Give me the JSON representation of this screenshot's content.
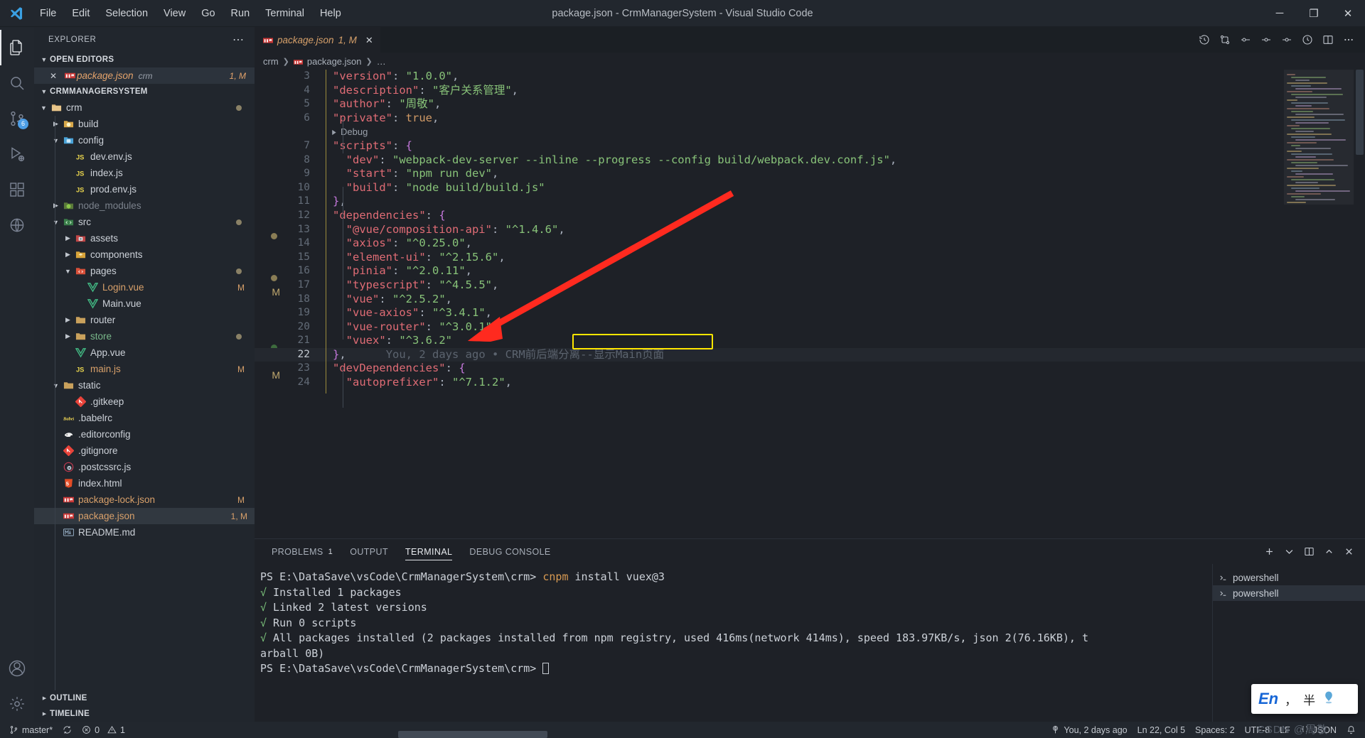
{
  "window": {
    "title": "package.json - CrmManagerSystem - Visual Studio Code",
    "minimize": "─",
    "maximize": "❐",
    "close": "✕"
  },
  "menu": [
    "File",
    "Edit",
    "Selection",
    "View",
    "Go",
    "Run",
    "Terminal",
    "Help"
  ],
  "activitybar": {
    "items": [
      {
        "name": "explorer-icon",
        "badge": ""
      },
      {
        "name": "search-icon",
        "badge": ""
      },
      {
        "name": "source-control-icon",
        "badge": "6"
      },
      {
        "name": "run-debug-icon",
        "badge": ""
      },
      {
        "name": "extensions-icon",
        "badge": ""
      },
      {
        "name": "remote-explorer-icon",
        "badge": ""
      }
    ],
    "bottom": [
      {
        "name": "accounts-icon"
      },
      {
        "name": "settings-gear-icon"
      }
    ]
  },
  "sidebar": {
    "title": "EXPLORER",
    "more_actions": "⋯",
    "open_editors": {
      "label": "OPEN EDITORS",
      "items": [
        {
          "name": "package.json",
          "sub": "crm",
          "badge": "1, M"
        }
      ]
    },
    "project": {
      "label": "CRMMANAGERSYSTEM",
      "tree": [
        {
          "label": "crm",
          "indent": 0,
          "kind": "folder-open",
          "icon": "folder-crm",
          "dot": true
        },
        {
          "label": "build",
          "indent": 1,
          "kind": "folder",
          "icon": "folder-build"
        },
        {
          "label": "config",
          "indent": 1,
          "kind": "folder-open",
          "icon": "folder-config"
        },
        {
          "label": "dev.env.js",
          "indent": 2,
          "kind": "file",
          "icon": "js"
        },
        {
          "label": "index.js",
          "indent": 2,
          "kind": "file",
          "icon": "js"
        },
        {
          "label": "prod.env.js",
          "indent": 2,
          "kind": "file",
          "icon": "js"
        },
        {
          "label": "node_modules",
          "indent": 1,
          "kind": "folder",
          "icon": "folder-node",
          "dim": true
        },
        {
          "label": "src",
          "indent": 1,
          "kind": "folder-open",
          "icon": "folder-src",
          "dot": true
        },
        {
          "label": "assets",
          "indent": 2,
          "kind": "folder",
          "icon": "folder-assets"
        },
        {
          "label": "components",
          "indent": 2,
          "kind": "folder",
          "icon": "folder-components"
        },
        {
          "label": "pages",
          "indent": 2,
          "kind": "folder-open",
          "icon": "folder-pages",
          "dot": true
        },
        {
          "label": "Login.vue",
          "indent": 3,
          "kind": "file",
          "icon": "vue",
          "badge": "M",
          "color": "orange"
        },
        {
          "label": "Main.vue",
          "indent": 3,
          "kind": "file",
          "icon": "vue"
        },
        {
          "label": "router",
          "indent": 2,
          "kind": "folder",
          "icon": "folder-plain"
        },
        {
          "label": "store",
          "indent": 2,
          "kind": "folder",
          "icon": "folder-plain",
          "color": "green",
          "dot": true
        },
        {
          "label": "App.vue",
          "indent": 2,
          "kind": "file",
          "icon": "vue"
        },
        {
          "label": "main.js",
          "indent": 2,
          "kind": "file",
          "icon": "js",
          "badge": "M",
          "color": "orange"
        },
        {
          "label": "static",
          "indent": 1,
          "kind": "folder-open",
          "icon": "folder-plain"
        },
        {
          "label": ".gitkeep",
          "indent": 2,
          "kind": "file",
          "icon": "git"
        },
        {
          "label": ".babelrc",
          "indent": 1,
          "kind": "file",
          "icon": "babel"
        },
        {
          "label": ".editorconfig",
          "indent": 1,
          "kind": "file",
          "icon": "editorconfig"
        },
        {
          "label": ".gitignore",
          "indent": 1,
          "kind": "file",
          "icon": "git"
        },
        {
          "label": ".postcssrc.js",
          "indent": 1,
          "kind": "file",
          "icon": "postcss"
        },
        {
          "label": "index.html",
          "indent": 1,
          "kind": "file",
          "icon": "html"
        },
        {
          "label": "package-lock.json",
          "indent": 1,
          "kind": "file",
          "icon": "npm",
          "badge": "M",
          "color": "orange"
        },
        {
          "label": "package.json",
          "indent": 1,
          "kind": "file",
          "icon": "npm",
          "badge": "1, M",
          "color": "orange",
          "selected": true
        },
        {
          "label": "README.md",
          "indent": 1,
          "kind": "file",
          "icon": "md"
        }
      ]
    },
    "outline": "OUTLINE",
    "timeline": "TIMELINE"
  },
  "editor": {
    "tab": {
      "label": "package.json",
      "badge": "1, M",
      "close": "✕"
    },
    "breadcrumb": [
      "crm",
      "package.json",
      "…"
    ],
    "codelens": "Debug",
    "blame": "You, 2 days ago • CRM前后端分离--显示Main页面",
    "lines": [
      {
        "n": "3",
        "html": "<span class=\"k\">\"version\"</span><span class=\"col\">: </span><span class=\"s\">\"1.0.0\"</span><span class=\"col\">,</span>",
        "indent": 1
      },
      {
        "n": "4",
        "html": "<span class=\"k\">\"description\"</span><span class=\"col\">: </span><span class=\"s\">\"客户关系管理\"</span><span class=\"col\">,</span>",
        "indent": 1
      },
      {
        "n": "5",
        "html": "<span class=\"k\">\"author\"</span><span class=\"col\">: </span><span class=\"s\">\"周敬\"</span><span class=\"col\">,</span>",
        "indent": 1
      },
      {
        "n": "6",
        "html": "<span class=\"k\">\"private\"</span><span class=\"col\">: </span><span class=\"num\">true</span><span class=\"col\">,</span>",
        "indent": 1
      },
      {
        "n": "7",
        "html": "<span class=\"k\">\"scripts\"</span><span class=\"col\">: </span><span class=\"p\">{</span>",
        "indent": 1
      },
      {
        "n": "8",
        "html": "  <span class=\"k\">\"dev\"</span><span class=\"col\">: </span><span class=\"s\">\"webpack-dev-server --inline --progress --config build/webpack.dev.conf.js\"</span><span class=\"col\">,</span>",
        "indent": 2
      },
      {
        "n": "9",
        "html": "  <span class=\"k\">\"start\"</span><span class=\"col\">: </span><span class=\"s\">\"npm run dev\"</span><span class=\"col\">,</span>",
        "indent": 2
      },
      {
        "n": "10",
        "html": "  <span class=\"k\">\"build\"</span><span class=\"col\">: </span><span class=\"s\">\"node build/build.js\"</span>",
        "indent": 2
      },
      {
        "n": "11",
        "html": "<span class=\"p\">}</span><span class=\"col\">,</span>",
        "indent": 1
      },
      {
        "n": "12",
        "html": "<span class=\"k\">\"dependencies\"</span><span class=\"col\">: </span><span class=\"p\">{</span>",
        "indent": 1
      },
      {
        "n": "13",
        "html": "  <span class=\"k\">\"@vue/composition-api\"</span><span class=\"col\">: </span><span class=\"s\">\"^1.4.6\"</span><span class=\"col\">,</span>",
        "indent": 2,
        "change": true,
        "glyphdot": true
      },
      {
        "n": "14",
        "html": "  <span class=\"k\">\"axios\"</span><span class=\"col\">: </span><span class=\"s\">\"^0.25.0\"</span><span class=\"col\">,</span>",
        "indent": 2
      },
      {
        "n": "15",
        "html": "  <span class=\"k\">\"element-ui\"</span><span class=\"col\">: </span><span class=\"s\">\"^2.15.6\"</span><span class=\"col\">,</span>",
        "indent": 2
      },
      {
        "n": "16",
        "html": "  <span class=\"k\">\"pinia\"</span><span class=\"col\">: </span><span class=\"s\">\"^2.0.11\"</span><span class=\"col\">,</span>",
        "indent": 2,
        "change": true,
        "glyphdot": true
      },
      {
        "n": "17",
        "html": "  <span class=\"k\">\"typescript\"</span><span class=\"col\">: </span><span class=\"s\">\"^4.5.5\"</span><span class=\"col\">,</span>",
        "indent": 2,
        "change": true,
        "glyphm": true
      },
      {
        "n": "18",
        "html": "  <span class=\"k\">\"vue\"</span><span class=\"col\">: </span><span class=\"s\">\"^2.5.2\"</span><span class=\"col\">,</span>",
        "indent": 2
      },
      {
        "n": "19",
        "html": "  <span class=\"k\">\"vue-axios\"</span><span class=\"col\">: </span><span class=\"s\">\"^3.4.1\"</span><span class=\"col\">,</span>",
        "indent": 2
      },
      {
        "n": "20",
        "html": "  <span class=\"k\">\"vue-router\"</span><span class=\"col\">: </span><span class=\"s\">\"^3.0.1\"</span><span class=\"col\">,</span>",
        "indent": 2,
        "change": true
      },
      {
        "n": "21",
        "html": "  <span class=\"k\">\"vuex\"</span><span class=\"col\">: </span><span class=\"s\">\"^3.6.2\"</span>",
        "indent": 2,
        "change": true,
        "glyphdotgreen": true
      },
      {
        "n": "22",
        "html": "<span class=\"p\">}</span><span class=\"col\">,</span>",
        "indent": 1,
        "current": true,
        "blame": true
      },
      {
        "n": "23",
        "html": "<span class=\"k\">\"devDependencies\"</span><span class=\"col\">: </span><span class=\"p\">{</span>",
        "indent": 1,
        "glyphm": true
      },
      {
        "n": "24",
        "html": "  <span class=\"k\">\"autoprefixer\"</span><span class=\"col\">: </span><span class=\"s\">\"^7.1.2\"</span><span class=\"col\">,</span>",
        "indent": 2
      }
    ]
  },
  "panel": {
    "tabs": [
      {
        "label": "PROBLEMS",
        "count": "1"
      },
      {
        "label": "OUTPUT",
        "count": ""
      },
      {
        "label": "TERMINAL",
        "count": "",
        "active": true
      },
      {
        "label": "DEBUG CONSOLE",
        "count": ""
      }
    ],
    "actions": [
      "new-terminal-icon",
      "chevron-down-icon",
      "split-terminal-icon",
      "maximize-panel-icon",
      "close-panel-icon"
    ],
    "terminal_lines": [
      {
        "type": "prompt",
        "prefix": "PS E:\\DataSave\\vsCode\\CrmManagerSystem\\crm> ",
        "cmd": "cnpm",
        "rest": " install vuex@3"
      },
      {
        "type": "ok",
        "text": "√ Installed 1 packages"
      },
      {
        "type": "ok",
        "text": "√ Linked 2 latest versions"
      },
      {
        "type": "ok",
        "text": "√ Run 0 scripts"
      },
      {
        "type": "ok",
        "text": "√ All packages installed (2 packages installed from npm registry, used 416ms(network 414ms), speed 183.97KB/s, json 2(76.16KB), t"
      },
      {
        "type": "plain",
        "text": "arball 0B)"
      },
      {
        "type": "prompt2",
        "prefix": "PS E:\\DataSave\\vsCode\\CrmManagerSystem\\crm> "
      }
    ],
    "terminal_tabs": [
      {
        "label": "powershell",
        "selected": false
      },
      {
        "label": "powershell",
        "selected": true
      }
    ]
  },
  "ime": {
    "lang": "En",
    "punct": "，",
    "width": "半",
    "logo": "ime-logo"
  },
  "statusbar": {
    "left": [
      {
        "name": "remote-branch",
        "text": "master*",
        "icon": "source-control-icon"
      },
      {
        "name": "sync-changes",
        "text": "",
        "icon": "sync-icon"
      },
      {
        "name": "problems",
        "text": "0",
        "icon": "error-icon"
      },
      {
        "name": "warnings",
        "text": "1",
        "icon": "warning-icon"
      }
    ],
    "right": [
      {
        "name": "git-blame",
        "text": "You, 2 days ago",
        "icon": "source-control-icon"
      },
      {
        "name": "cursor-position",
        "text": "Ln 22, Col 5"
      },
      {
        "name": "indentation",
        "text": "Spaces: 2"
      },
      {
        "name": "encoding",
        "text": "UTF-8"
      },
      {
        "name": "eol",
        "text": "LF"
      },
      {
        "name": "language-mode",
        "text": "JSON",
        "icon": "braces-icon"
      },
      {
        "name": "notifications",
        "text": "",
        "icon": "bell-icon"
      }
    ],
    "watermark": "CSDN @周敬"
  },
  "colors": {
    "accent": "#4d9ee6",
    "highlight_box": "#ffe600",
    "arrow": "#ff2a1f",
    "bg": "#1e2127",
    "sidebar_bg": "#21262d",
    "titlebar_bg": "#22272e"
  }
}
